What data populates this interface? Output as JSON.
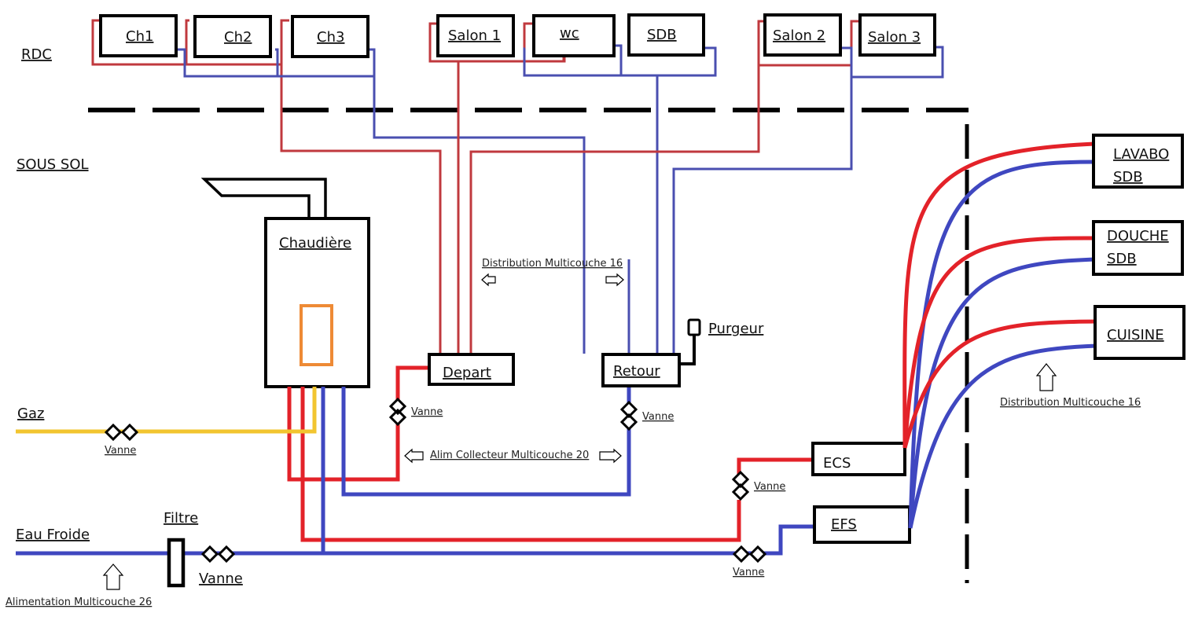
{
  "levels": {
    "upper": "RDC",
    "lower": "SOUS SOL"
  },
  "rooms_rdc": [
    {
      "id": "ch1",
      "label": "Ch1"
    },
    {
      "id": "ch2",
      "label": "Ch2"
    },
    {
      "id": "ch3",
      "label": "Ch3"
    },
    {
      "id": "salon1",
      "label": "Salon 1"
    },
    {
      "id": "wc",
      "label": "wc"
    },
    {
      "id": "sdb",
      "label": "SDB"
    },
    {
      "id": "salon2",
      "label": "Salon 2"
    },
    {
      "id": "salon3",
      "label": "Salon 3"
    }
  ],
  "equipment": {
    "boiler": "Chaudière",
    "depart": "Depart",
    "retour": "Retour",
    "purgeur": "Purgeur",
    "ecs": "ECS",
    "efs": "EFS",
    "filtre": "Filtre"
  },
  "supplies": {
    "gas": "Gaz",
    "cold_water": "Eau Froide"
  },
  "fixtures": [
    {
      "id": "lavabo",
      "line1": "LAVABO",
      "line2": "SDB"
    },
    {
      "id": "douche",
      "line1": "DOUCHE",
      "line2": "SDB"
    },
    {
      "id": "cuisine",
      "line1": "CUISINE",
      "line2": ""
    }
  ],
  "valves": {
    "gas": "Vanne",
    "main_water": "Vanne",
    "depart": "Vanne",
    "retour": "Vanne",
    "ecs": "Vanne",
    "efs": "Vanne"
  },
  "annotations": {
    "distribution_collector": "Distribution Multicouche 16",
    "alim_collector": "Alim Collecteur Multicouche 20",
    "alimentation": "Alimentation  Multicouche 26",
    "distribution_fixtures": "Distribution Multicouche 16"
  },
  "colors": {
    "hot": "#e32229",
    "cold": "#3f47c0",
    "hot_heating": "#c0393e",
    "cold_heating": "#4a4fb0",
    "gas": "#f2c530",
    "burner": "#ee8a35"
  }
}
